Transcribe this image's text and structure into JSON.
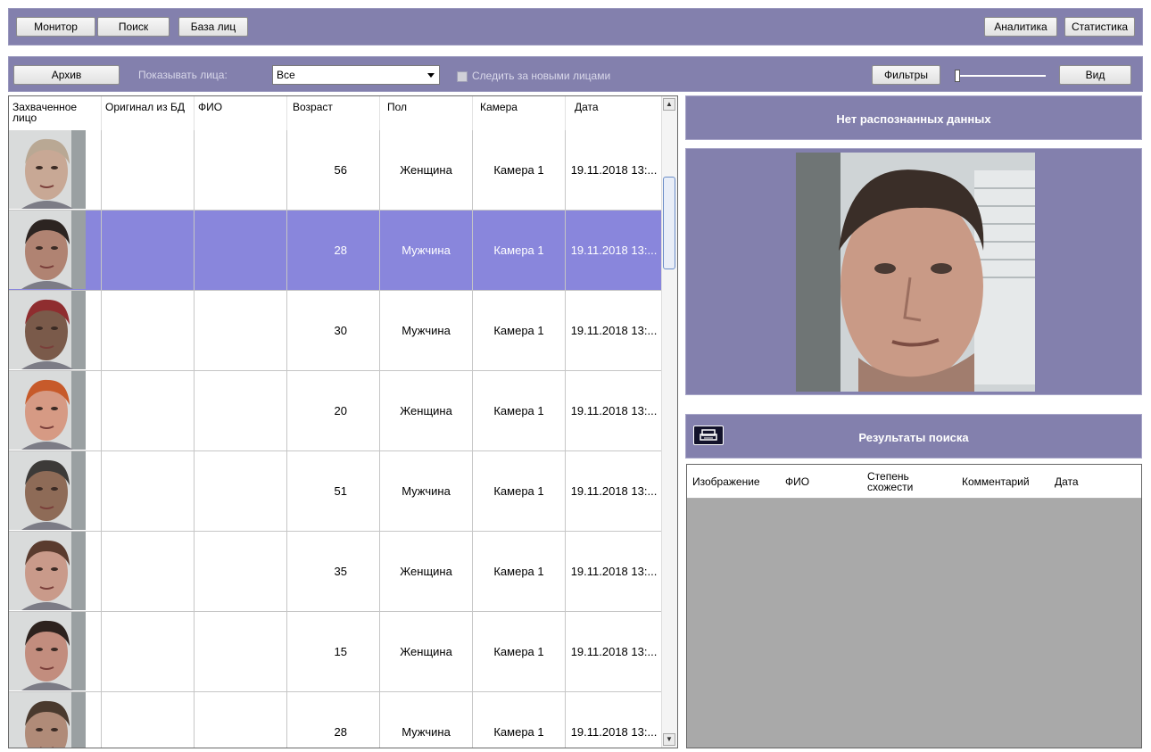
{
  "top_toolbar": {
    "monitor": "Монитор",
    "search": "Поиск",
    "face_db": "База лиц",
    "analytics": "Аналитика",
    "statistics": "Статистика"
  },
  "second_toolbar": {
    "archive": "Архив",
    "show_faces_label": "Показывать лица:",
    "show_faces_value": "Все",
    "follow_new_label": "Следить за новыми лицами",
    "follow_new_checked": false,
    "filters": "Фильтры",
    "view": "Вид"
  },
  "table": {
    "columns": [
      "Захваченное лицо",
      "Оригинал из БД",
      "ФИО",
      "Возраст",
      "Пол",
      "Камера",
      "Дата"
    ],
    "rows": [
      {
        "age": "56",
        "gender": "Женщина",
        "camera": "Камера 1",
        "date": "19.11.2018 13:...",
        "selected": false
      },
      {
        "age": "28",
        "gender": "Мужчина",
        "camera": "Камера 1",
        "date": "19.11.2018 13:...",
        "selected": true
      },
      {
        "age": "30",
        "gender": "Мужчина",
        "camera": "Камера 1",
        "date": "19.11.2018 13:...",
        "selected": false
      },
      {
        "age": "20",
        "gender": "Женщина",
        "camera": "Камера 1",
        "date": "19.11.2018 13:...",
        "selected": false
      },
      {
        "age": "51",
        "gender": "Мужчина",
        "camera": "Камера 1",
        "date": "19.11.2018 13:...",
        "selected": false
      },
      {
        "age": "35",
        "gender": "Женщина",
        "camera": "Камера 1",
        "date": "19.11.2018 13:...",
        "selected": false
      },
      {
        "age": "15",
        "gender": "Женщина",
        "camera": "Камера 1",
        "date": "19.11.2018 13:...",
        "selected": false
      },
      {
        "age": "28",
        "gender": "Мужчина",
        "camera": "Камера 1",
        "date": "19.11.2018 13:...",
        "selected": false
      }
    ]
  },
  "recognition": {
    "title": "Нет распознанных данных"
  },
  "search_results": {
    "title": "Результаты поиска",
    "columns": [
      "Изображение",
      "ФИО",
      "Степень схожести",
      "Комментарий",
      "Дата"
    ]
  },
  "colors": {
    "toolbar_bg": "#8380ad",
    "selected_row": "#8986dc",
    "results_bg": "#a9a9a9"
  }
}
